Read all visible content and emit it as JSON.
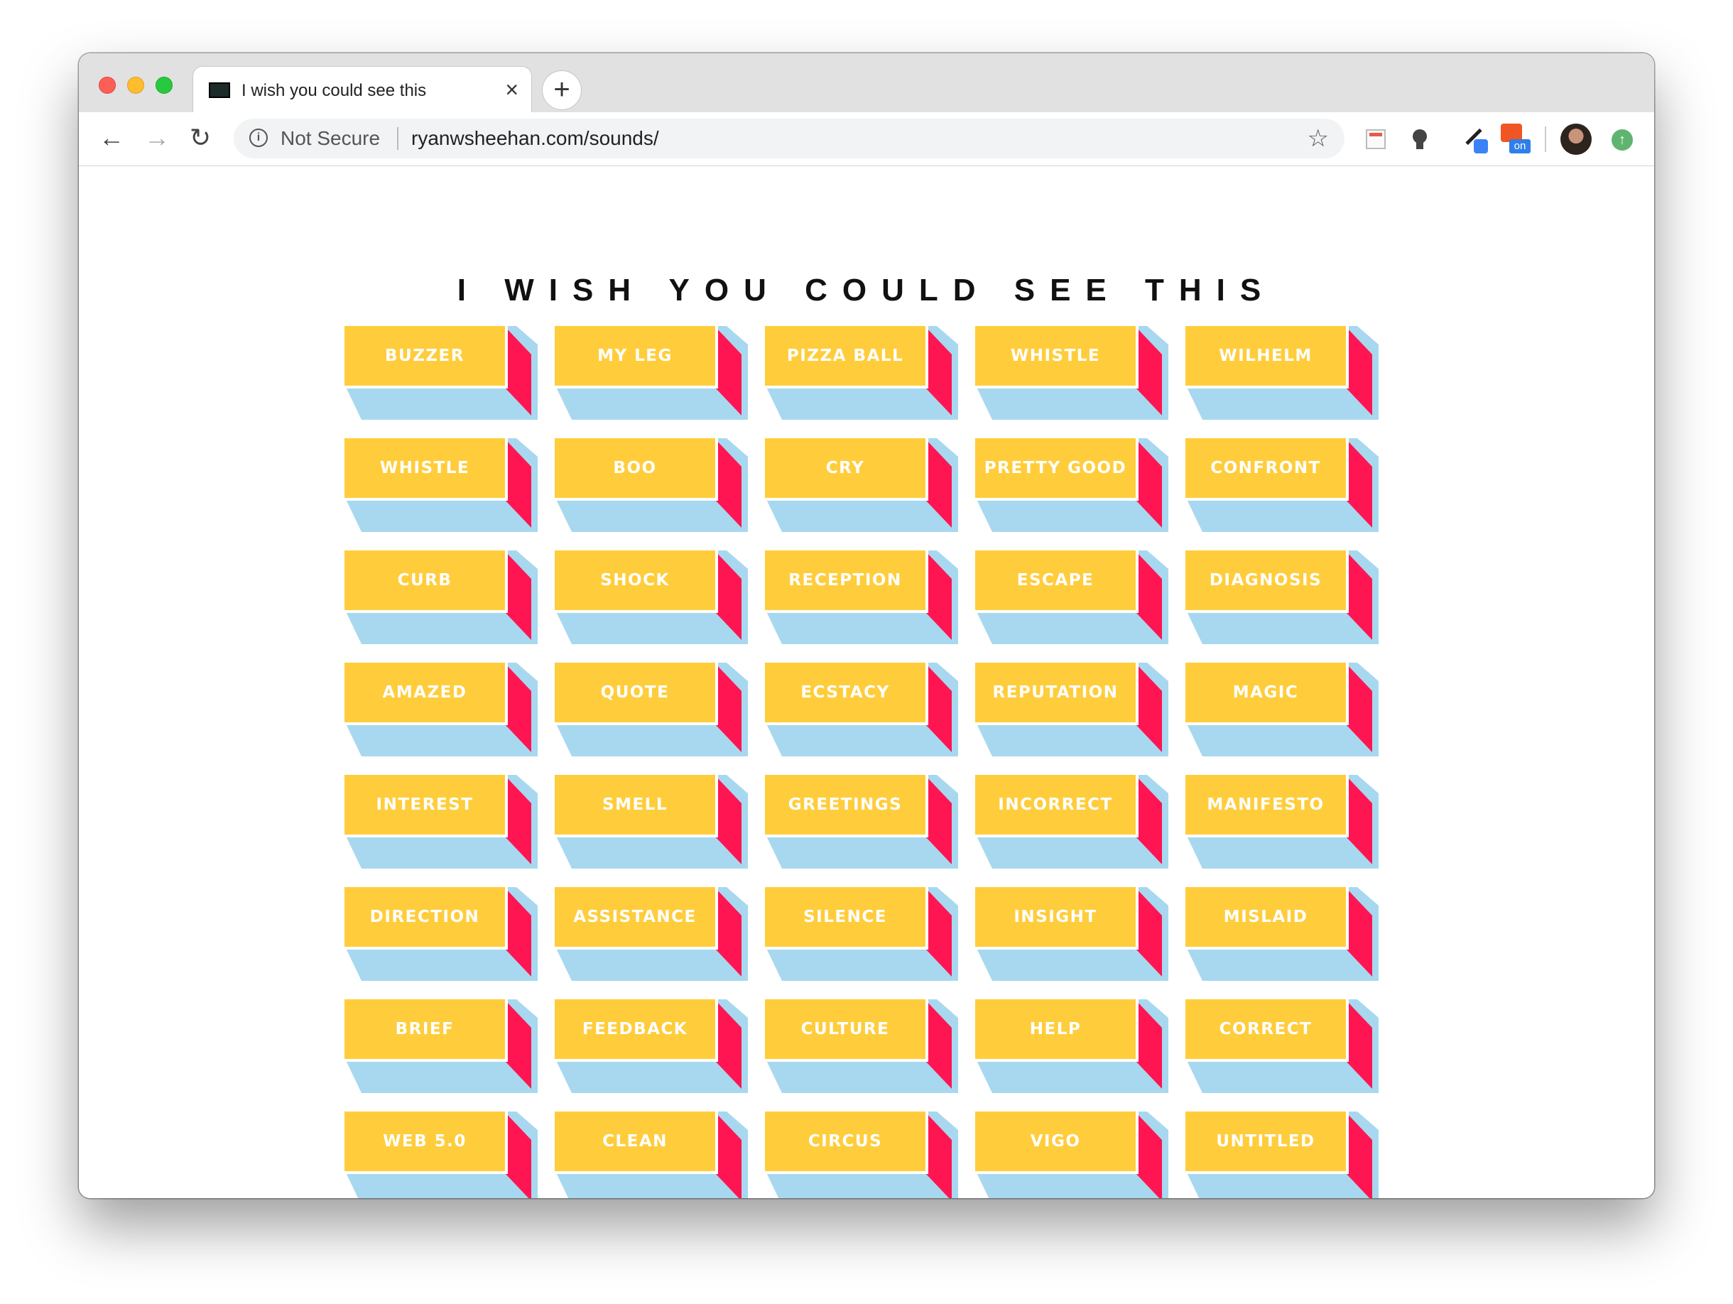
{
  "browser": {
    "tab_title": "I wish you could see this",
    "tab_close": "×",
    "new_tab": "+",
    "security_label": "Not Secure",
    "url": "ryanwsheehan.com/sounds/",
    "extension_badge": "on"
  },
  "page": {
    "title": "I WISH YOU COULD SEE THIS"
  },
  "sounds": [
    "BUZZER",
    "MY LEG",
    "PIZZA BALL",
    "WHISTLE",
    "WILHELM",
    "WHISTLE",
    "BOO",
    "CRY",
    "PRETTY GOOD",
    "CONFRONT",
    "CURB",
    "SHOCK",
    "RECEPTION",
    "ESCAPE",
    "DIAGNOSIS",
    "AMAZED",
    "QUOTE",
    "ECSTACY",
    "REPUTATION",
    "MAGIC",
    "INTEREST",
    "SMELL",
    "GREETINGS",
    "INCORRECT",
    "MANIFESTO",
    "DIRECTION",
    "ASSISTANCE",
    "SILENCE",
    "INSIGHT",
    "MISLAID",
    "BRIEF",
    "FEEDBACK",
    "CULTURE",
    "HELP",
    "CORRECT",
    "WEB 5.0",
    "CLEAN",
    "CIRCUS",
    "VIGO",
    "UNTITLED"
  ],
  "colors": {
    "button_face": "#ffcd3c",
    "button_side": "#ff1552",
    "button_shadow": "#a8d8ef"
  },
  "icons": {
    "back": "arrow-left-icon",
    "forward": "arrow-right-icon",
    "reload": "reload-icon",
    "info": "info-icon",
    "bookmark": "star-icon"
  }
}
